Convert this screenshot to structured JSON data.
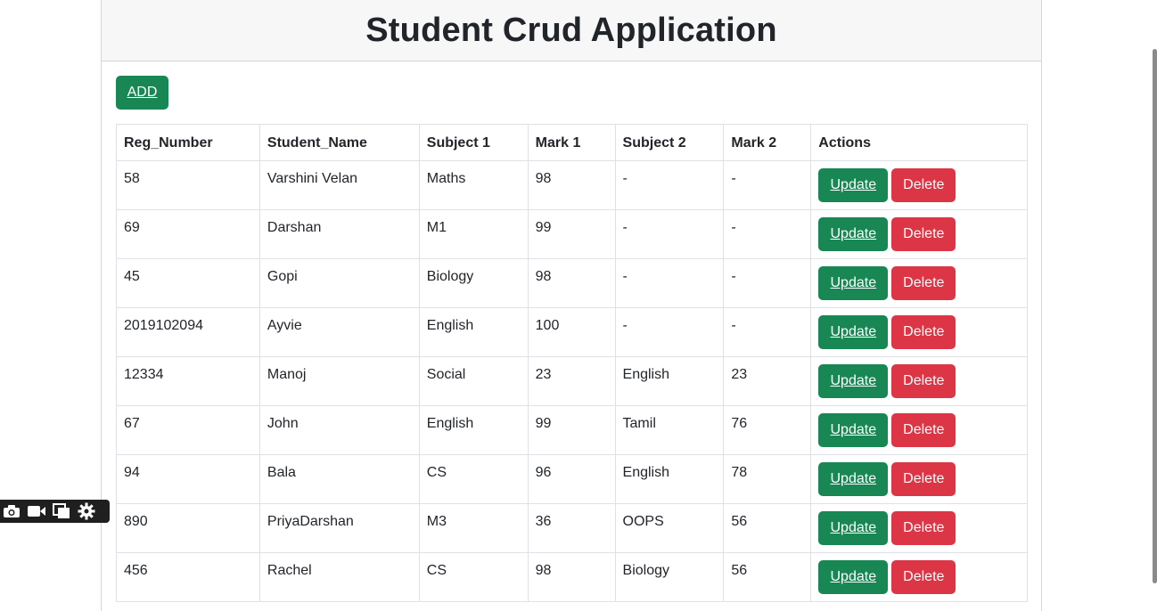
{
  "header": {
    "title": "Student Crud Application"
  },
  "toolbar": {
    "add_label": "ADD"
  },
  "table": {
    "columns": [
      "Reg_Number",
      "Student_Name",
      "Subject 1",
      "Mark 1",
      "Subject 2",
      "Mark 2",
      "Actions"
    ],
    "update_label": "Update",
    "delete_label": "Delete",
    "rows": [
      {
        "reg": "58",
        "name": "Varshini Velan",
        "subject1": "Maths",
        "mark1": "98",
        "subject2": "-",
        "mark2": "-"
      },
      {
        "reg": "69",
        "name": "Darshan",
        "subject1": "M1",
        "mark1": "99",
        "subject2": "-",
        "mark2": "-"
      },
      {
        "reg": "45",
        "name": "Gopi",
        "subject1": "Biology",
        "mark1": "98",
        "subject2": "-",
        "mark2": "-"
      },
      {
        "reg": "2019102094",
        "name": "Ayvie",
        "subject1": "English",
        "mark1": "100",
        "subject2": "-",
        "mark2": "-"
      },
      {
        "reg": "12334",
        "name": "Manoj",
        "subject1": "Social",
        "mark1": "23",
        "subject2": "English",
        "mark2": "23"
      },
      {
        "reg": "67",
        "name": "John",
        "subject1": "English",
        "mark1": "99",
        "subject2": "Tamil",
        "mark2": "76"
      },
      {
        "reg": "94",
        "name": "Bala",
        "subject1": "CS",
        "mark1": "96",
        "subject2": "English",
        "mark2": "78"
      },
      {
        "reg": "890",
        "name": "PriyaDarshan",
        "subject1": "M3",
        "mark1": "36",
        "subject2": "OOPS",
        "mark2": "56"
      },
      {
        "reg": "456",
        "name": "Rachel",
        "subject1": "CS",
        "mark1": "98",
        "subject2": "Biology",
        "mark2": "56"
      }
    ]
  },
  "overlay_toolbar": {
    "icons": [
      "camera-icon",
      "video-camera-icon",
      "copy-windows-icon",
      "gear-icon"
    ]
  },
  "colors": {
    "success": "#198754",
    "danger": "#dc3545",
    "header_bg": "#f7f7f7",
    "border": "#dee2e6"
  }
}
